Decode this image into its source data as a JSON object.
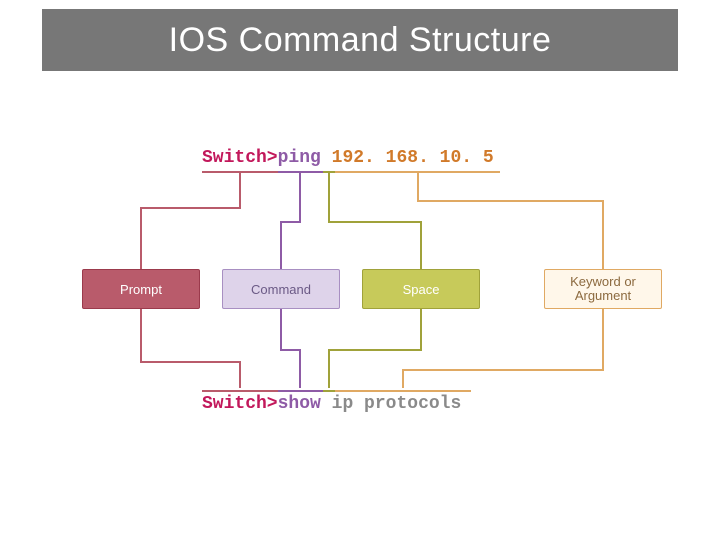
{
  "title": "IOS Command Structure",
  "example_top": {
    "prompt": "Switch>",
    "command": "ping",
    "space": " ",
    "argument": "192. 168. 10. 5"
  },
  "example_bottom": {
    "prompt": "Switch>",
    "command": "show",
    "space": " ",
    "argument": "ip protocols"
  },
  "labels": {
    "prompt": "Prompt",
    "command": "Command",
    "space": "Space",
    "argument": "Keyword or Argument"
  },
  "colors": {
    "prompt": "#b95b6b",
    "command": "#8e5ba6",
    "space": "#a0a23a",
    "argument": "#e0a963"
  }
}
